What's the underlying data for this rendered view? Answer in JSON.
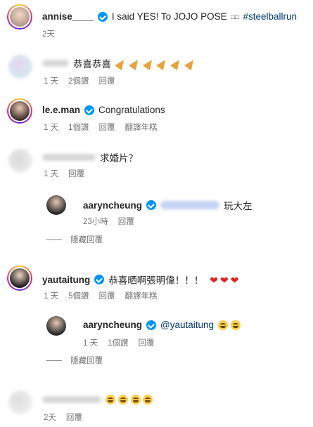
{
  "comments": [
    {
      "username": "annise____",
      "text": "I said YES! To JOJO POSE",
      "glyphs": "□□",
      "hashtag": "#steelballrun",
      "time": "2天"
    },
    {
      "username": "",
      "text": "恭喜恭喜",
      "emoji": "party-popper x6",
      "time": "1 天",
      "likes": "2個讚",
      "reply": "回覆"
    },
    {
      "username": "le.e.man",
      "text": "Congratulations",
      "time": "1 天",
      "likes": "1個讚",
      "reply": "回覆",
      "translate": "翻譯年糕"
    },
    {
      "username": "",
      "text": "求婚片？",
      "time": "1 天",
      "reply": "回覆"
    },
    {
      "username": "aaryncheung",
      "text": "玩大左",
      "time": "23小時",
      "reply": "回覆",
      "hide": "隱藏回覆"
    },
    {
      "username": "yautaitung",
      "text": "恭喜晒啊張明偉！！！",
      "emoji": "red-heart x3",
      "time": "1 天",
      "likes": "5個讚",
      "reply": "回覆",
      "translate": "翻譯年糕"
    },
    {
      "username": "aaryncheung",
      "mention": "@yautaitung",
      "emoji": "grinning-squinting x2",
      "time": "1 天",
      "likes": "1個讚",
      "reply": "回覆",
      "hide": "隱藏回覆"
    },
    {
      "username": "",
      "emoji": "grinning-squinting x4",
      "time": "2天",
      "reply": "回覆"
    }
  ],
  "colors": {
    "link": "#00376b",
    "verified": "#0095f6",
    "meta": "#737373",
    "heart": "#e02424"
  }
}
